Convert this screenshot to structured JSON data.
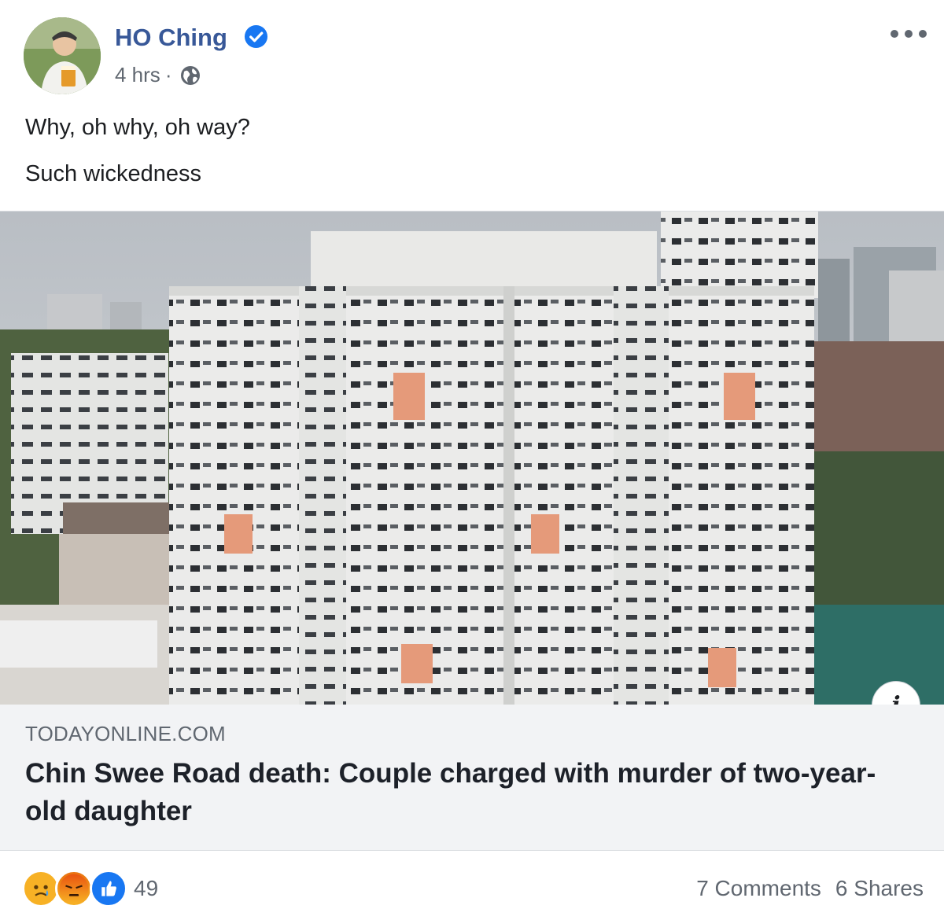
{
  "post": {
    "author": "HO Ching",
    "time": "4 hrs",
    "separator": "·",
    "lines": [
      "Why, oh why, oh way?",
      "Such wickedness"
    ]
  },
  "link": {
    "domain": "TODAYONLINE.COM",
    "headline": "Chin Swee Road death: Couple charged with murder of two-year-old daughter",
    "info_label": "i"
  },
  "footer": {
    "reaction_count": "49",
    "comments": "7 Comments",
    "shares": "6 Shares",
    "reactions": [
      "sad-reaction-icon",
      "angry-reaction-icon",
      "like-reaction-icon"
    ]
  },
  "colors": {
    "author": "#385898",
    "verified": "#1877f2",
    "caption_bg": "#f2f3f5",
    "secondary_text": "#606770"
  }
}
